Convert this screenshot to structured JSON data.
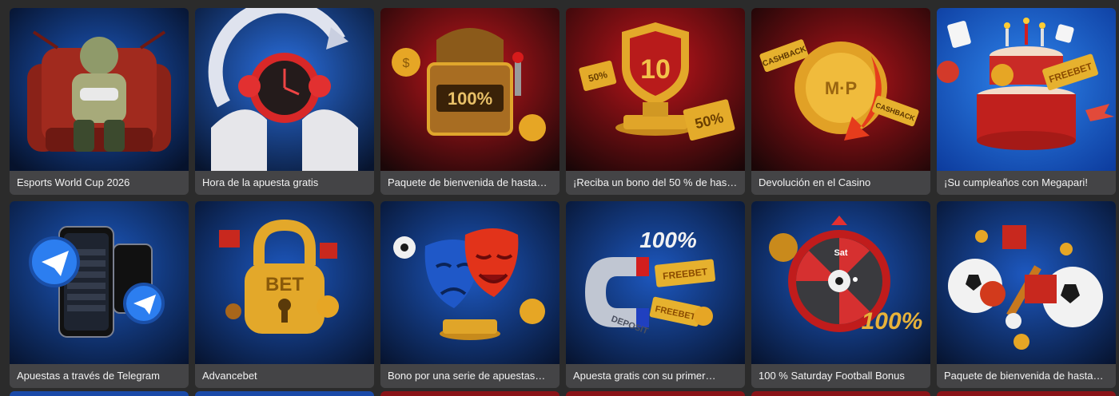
{
  "promotions": [
    {
      "title": "Esports World Cup 2026",
      "icon": "gamer-armchair-icon"
    },
    {
      "title": "Hora de la apuesta gratis",
      "icon": "clock-icon"
    },
    {
      "title": "Paquete de bienvenida de hasta…",
      "icon": "treasure-chest-icon",
      "badge": "100%"
    },
    {
      "title": "¡Reciba un bono del 50 % de hasta…",
      "icon": "trophy-shield-icon",
      "badge": "10",
      "tag1": "50%",
      "tag2": "50%"
    },
    {
      "title": "Devolución en el Casino",
      "icon": "cashback-coin-icon",
      "badge": "M·P",
      "tag1": "CASHBACK",
      "tag2": "CASHBACK"
    },
    {
      "title": "¡Su cumpleaños con Megapari!",
      "icon": "birthday-cake-icon",
      "tag1": "FREEBET"
    },
    {
      "title": "Apuestas a través de Telegram",
      "icon": "telegram-phone-icon"
    },
    {
      "title": "Advancebet",
      "icon": "padlock-icon",
      "badge": "BET"
    },
    {
      "title": "Bono por una serie de apuestas…",
      "icon": "theater-masks-icon"
    },
    {
      "title": "Apuesta gratis con su primer…",
      "icon": "magnet-icon",
      "badge": "100%",
      "tag1": "FREEBET",
      "tag2": "FREEBET",
      "tag3": "DEPOSIT"
    },
    {
      "title": "100 % Saturday Football Bonus",
      "icon": "fortune-wheel-icon",
      "badge": "100%",
      "tag1": "Sat"
    },
    {
      "title": "Paquete de bienvenida de hasta…",
      "icon": "sports-balls-icon"
    }
  ],
  "colors": {
    "page_bg": "#2b2b2b",
    "caption_bg": "#444446",
    "blue_bg": "#1560c8",
    "red_bg": "#b5141a",
    "gold": "#e3a82a"
  }
}
